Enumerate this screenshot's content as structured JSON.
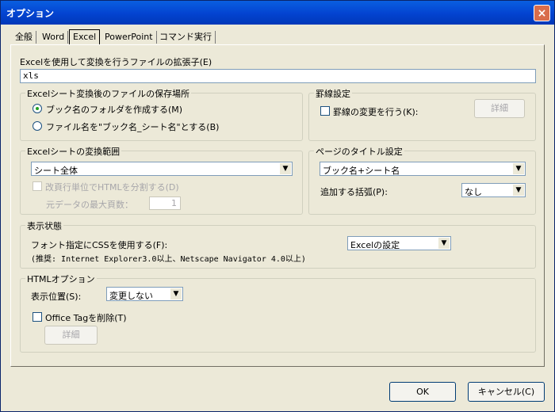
{
  "window": {
    "title": "オプション",
    "close_glyph": "×"
  },
  "tabs": [
    {
      "label": "全般"
    },
    {
      "label": "Word"
    },
    {
      "label": "Excel",
      "active": true
    },
    {
      "label": "PowerPoint"
    },
    {
      "label": "コマンド実行"
    }
  ],
  "ext": {
    "label": "Excelを使用して変換を行うファイルの拡張子(E)",
    "value": "xls"
  },
  "save_location": {
    "title": "Excelシート変換後のファイルの保存場所",
    "option1": "ブック名のフォルダを作成する(M)",
    "option2": "ファイル名を\"ブック名_シート名\"とする(B)",
    "selected": 1
  },
  "ruled": {
    "title": "罫線設定",
    "checkbox": "罫線の変更を行う(K):",
    "details": "詳細"
  },
  "range": {
    "title": "Excelシートの変換範囲",
    "combo": "シート全体",
    "split_checkbox": "改頁行単位でHTMLを分割する(D)",
    "max_pages_label": "元データの最大頁数：",
    "max_pages_value": "1"
  },
  "page_title": {
    "title": "ページのタイトル設定",
    "combo": "ブック名+シート名",
    "bracket_label": "追加する括弧(P):",
    "bracket_value": "なし"
  },
  "display": {
    "title": "表示状態",
    "css_label": "フォント指定にCSSを使用する(F):",
    "css_value": "Excelの設定",
    "note": "(推奨: Internet Explorer3.0以上、Netscape Navigator 4.0以上)"
  },
  "html_option": {
    "title": "HTMLオプション",
    "position_label": "表示位置(S):",
    "position_value": "変更しない",
    "office_tag_checkbox": "Office Tagを削除(T)",
    "details": "詳細"
  },
  "buttons": {
    "ok": "OK",
    "cancel": "キャンセル(C)"
  }
}
